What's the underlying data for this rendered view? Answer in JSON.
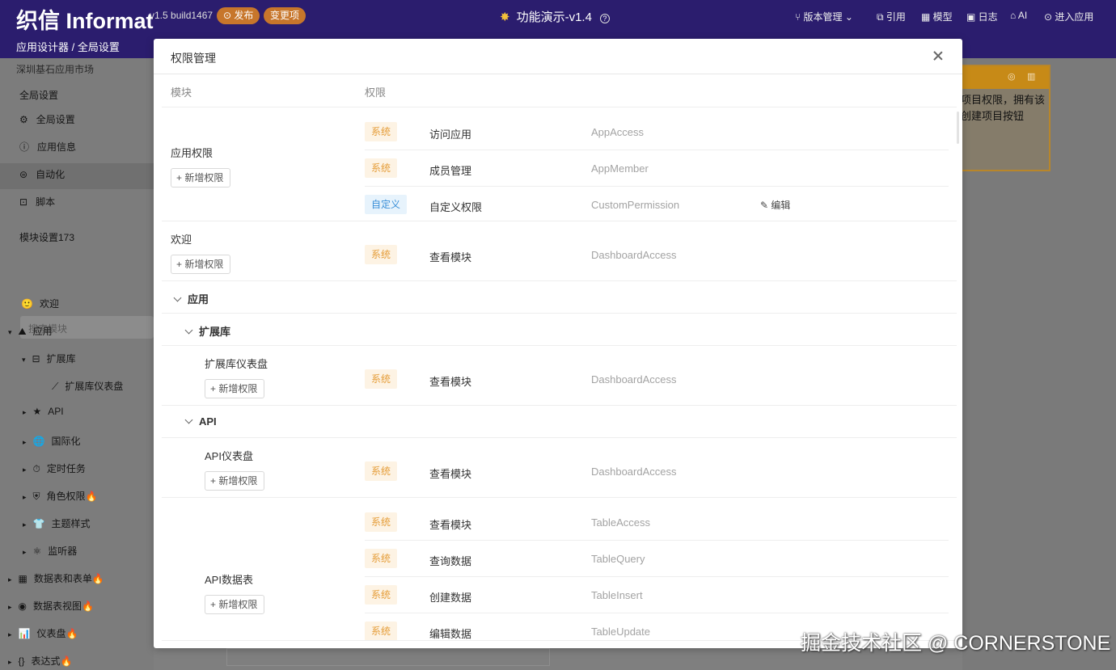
{
  "topbar": {
    "logo": "织信 Informat",
    "version": "v1.5 build1467",
    "publish": "⊙ 发布",
    "changes": "变更项",
    "title": "功能演示-v1.4",
    "nav": [
      "版本管理",
      "引用",
      "模型",
      "日志",
      "AI",
      "进入应用"
    ]
  },
  "breadcrumb": "应用设计器 / 全局设置",
  "sidebar": {
    "market": "深圳基石应用市场",
    "global_section": "全局设置",
    "items": [
      "全局设置",
      "应用信息",
      "自动化",
      "脚本"
    ],
    "module_section": "模块设置173",
    "search_placeholder": "搜索模块",
    "tree": [
      "欢迎",
      "应用",
      "扩展库",
      "扩展库仪表盘",
      "API",
      "国际化",
      "定时任务",
      "角色权限🔥",
      "主题样式",
      "监听器",
      "数据表和表单🔥",
      "数据表视图🔥",
      "仪表盘🔥",
      "表达式🔥"
    ]
  },
  "rightcard": {
    "text": "项目权限，拥有该创建项目按钮"
  },
  "modal": {
    "title": "权限管理",
    "col_module": "模块",
    "col_perm": "权限",
    "add_label": "新增权限",
    "edit_label": "编辑",
    "groups": {
      "app": "应用",
      "ext": "扩展库",
      "api": "API"
    },
    "sections": [
      {
        "module": "应用权限",
        "perms": [
          {
            "tag": "系统",
            "name": "访问应用",
            "code": "AppAccess"
          },
          {
            "tag": "系统",
            "name": "成员管理",
            "code": "AppMember"
          },
          {
            "tag": "自定义",
            "name": "自定义权限",
            "code": "CustomPermission"
          }
        ]
      },
      {
        "module": "欢迎",
        "perms": [
          {
            "tag": "系统",
            "name": "查看模块",
            "code": "DashboardAccess"
          }
        ]
      },
      {
        "module": "扩展库仪表盘",
        "perms": [
          {
            "tag": "系统",
            "name": "查看模块",
            "code": "DashboardAccess"
          }
        ]
      },
      {
        "module": "API仪表盘",
        "perms": [
          {
            "tag": "系统",
            "name": "查看模块",
            "code": "DashboardAccess"
          }
        ]
      },
      {
        "module": "API数据表",
        "perms": [
          {
            "tag": "系统",
            "name": "查看模块",
            "code": "TableAccess"
          },
          {
            "tag": "系统",
            "name": "查询数据",
            "code": "TableQuery"
          },
          {
            "tag": "系统",
            "name": "创建数据",
            "code": "TableInsert"
          },
          {
            "tag": "系统",
            "name": "编辑数据",
            "code": "TableUpdate"
          }
        ]
      }
    ]
  },
  "watermark": "掘金技术社区 @ CORNERSTONE"
}
